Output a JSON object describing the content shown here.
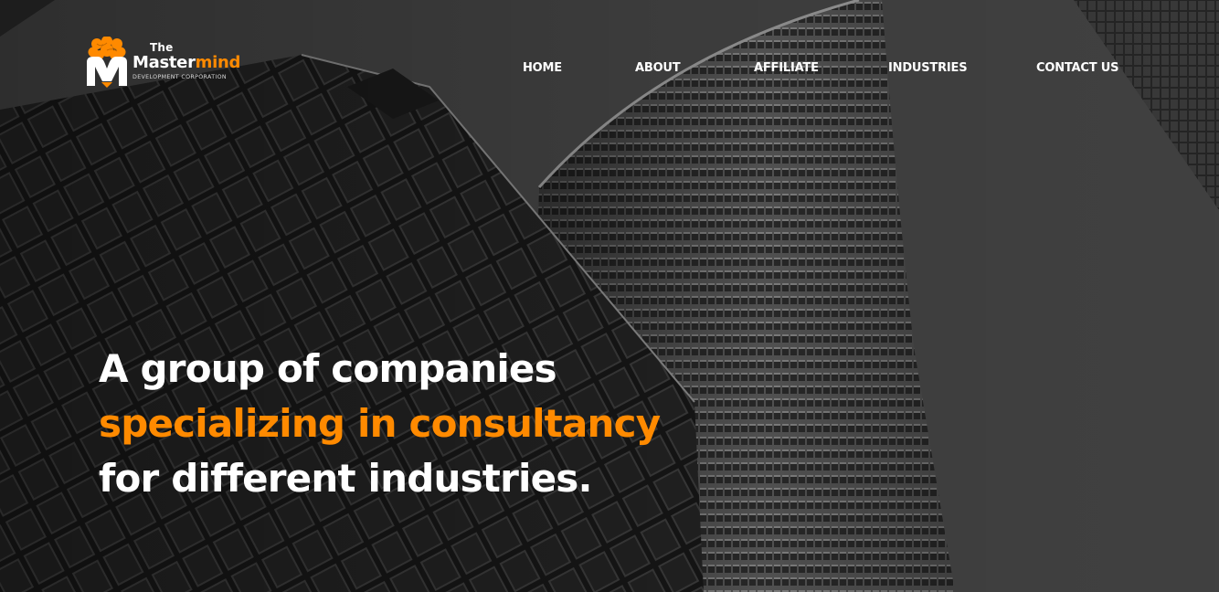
{
  "brand": {
    "the": "The",
    "name_plain": "Master",
    "name_accent": "mind",
    "subtitle": "DEVELOPMENT CORPORATION"
  },
  "nav": {
    "home": "HOME",
    "about": "ABOUT",
    "affiliate": "AFFILIATE",
    "industries": "INDUSTRIES",
    "contact": "CONTACT US"
  },
  "hero": {
    "line1": "A group of companies",
    "line2": "specializing in consultancy",
    "line3": "for different industries."
  },
  "colors": {
    "accent": "#ff8a00",
    "text": "#ffffff",
    "background": "#3f3f3f"
  },
  "icons": {
    "logo": "brain-m-logo-icon"
  }
}
